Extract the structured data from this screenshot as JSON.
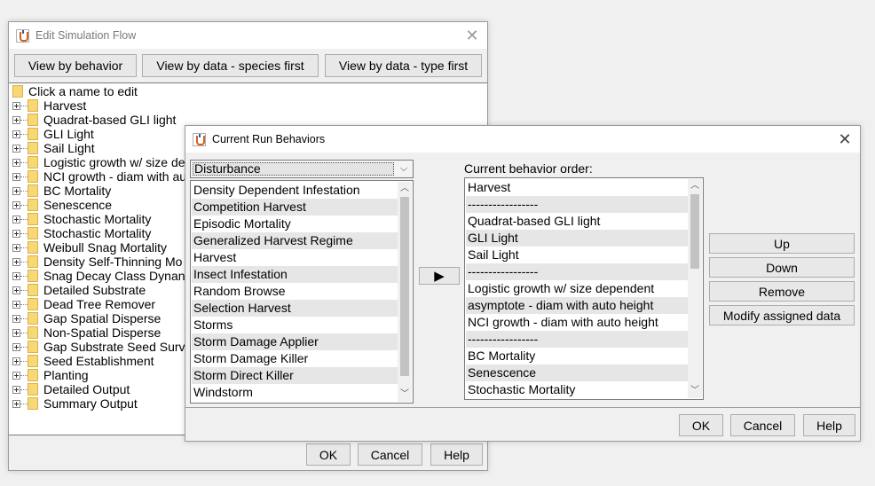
{
  "edit_window": {
    "title": "Edit Simulation Flow",
    "tabs": [
      "View by behavior",
      "View by data - species first",
      "View by data - type first"
    ],
    "tree_root": "Click a name to edit",
    "tree_items": [
      "Harvest",
      "Quadrat-based GLI light",
      "GLI Light",
      "Sail Light",
      "Logistic growth w/ size de",
      "NCI growth - diam with au",
      "BC Mortality",
      "Senescence",
      "Stochastic Mortality",
      "Stochastic Mortality",
      "Weibull Snag Mortality",
      "Density Self-Thinning Mo",
      "Snag Decay Class Dynan",
      "Detailed Substrate",
      "Dead Tree Remover",
      "Gap Spatial Disperse",
      "Non-Spatial Disperse",
      "Gap Substrate Seed Surv",
      "Seed Establishment",
      "Planting",
      "Detailed Output",
      "Summary Output"
    ],
    "ok_label": "OK",
    "cancel_label": "Cancel",
    "help_label": "Help"
  },
  "run_window": {
    "title": "Current Run Behaviors",
    "close_icon": "close-icon",
    "dropdown_value": "Disturbance",
    "behavior_list": [
      "Density Dependent Infestation",
      "Competition Harvest",
      "Episodic Mortality",
      "Generalized Harvest Regime",
      "Harvest",
      "Insect Infestation",
      "Random Browse",
      "Selection Harvest",
      "Storms",
      "Storm Damage Applier",
      "Storm Damage Killer",
      "Storm Direct Killer",
      "Windstorm"
    ],
    "add_arrow_label": "▶",
    "order_label": "Current behavior order:",
    "order_list": [
      "Harvest",
      "-----------------",
      "Quadrat-based GLI light",
      "GLI Light",
      "Sail Light",
      "-----------------",
      "Logistic growth w/ size dependent",
      "asymptote - diam with auto height",
      "NCI growth - diam with auto height",
      "-----------------",
      "BC Mortality",
      "Senescence",
      "Stochastic Mortality"
    ],
    "up_label": "Up",
    "down_label": "Down",
    "remove_label": "Remove",
    "modify_label": "Modify assigned data",
    "ok_label": "OK",
    "cancel_label": "Cancel",
    "help_label": "Help"
  }
}
